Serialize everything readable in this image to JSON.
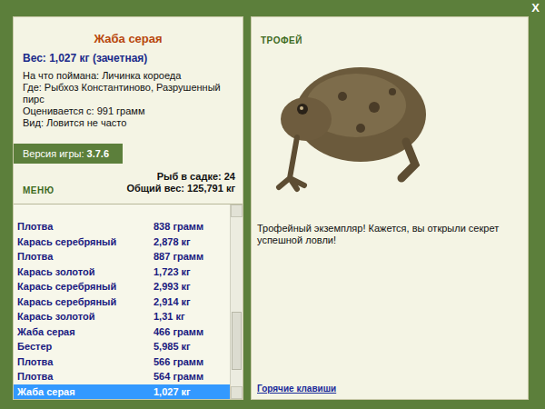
{
  "window": {
    "close": "X"
  },
  "fish": {
    "title": "Жаба серая",
    "weight": "Вес: 1,027 кг (зачетная)",
    "details": [
      "На что поймана: Личинка короеда",
      "Где: Рыбхоз Константиново, Разрушенный пирс",
      "Оценивается с: 991 грамм",
      "Вид: Ловится не часто"
    ]
  },
  "version": {
    "label": "Версия игры:",
    "value": "3.7.6"
  },
  "menu": "МЕНЮ",
  "cage": {
    "count": "Рыб в садке: 24",
    "total": "Общий вес: 125,791 кг"
  },
  "catch_list": {
    "rows": [
      {
        "name": "Плотва",
        "weight": "838 грамм",
        "selected": false
      },
      {
        "name": "Карась серебряный",
        "weight": "2,878 кг",
        "selected": false
      },
      {
        "name": "Плотва",
        "weight": "887 грамм",
        "selected": false
      },
      {
        "name": "Карась золотой",
        "weight": "1,723 кг",
        "selected": false
      },
      {
        "name": "Карась серебряный",
        "weight": "2,993 кг",
        "selected": false
      },
      {
        "name": "Карась серебряный",
        "weight": "2,914 кг",
        "selected": false
      },
      {
        "name": "Карась золотой",
        "weight": "1,31 кг",
        "selected": false
      },
      {
        "name": "Жаба серая",
        "weight": "466 грамм",
        "selected": false
      },
      {
        "name": "Бестер",
        "weight": "5,985 кг",
        "selected": false
      },
      {
        "name": "Плотва",
        "weight": "566 грамм",
        "selected": false
      },
      {
        "name": "Плотва",
        "weight": "564 грамм",
        "selected": false
      },
      {
        "name": "Жаба серая",
        "weight": "1,027 кг",
        "selected": true
      }
    ],
    "scrollbar": {
      "level": 0.85
    }
  },
  "trophy": {
    "label": "ТРОФЕЙ",
    "message": "Трофейный экземпляр! Кажется, вы открыли секрет успешной ловли!"
  },
  "hotkeys": "Горячие клавиши"
}
